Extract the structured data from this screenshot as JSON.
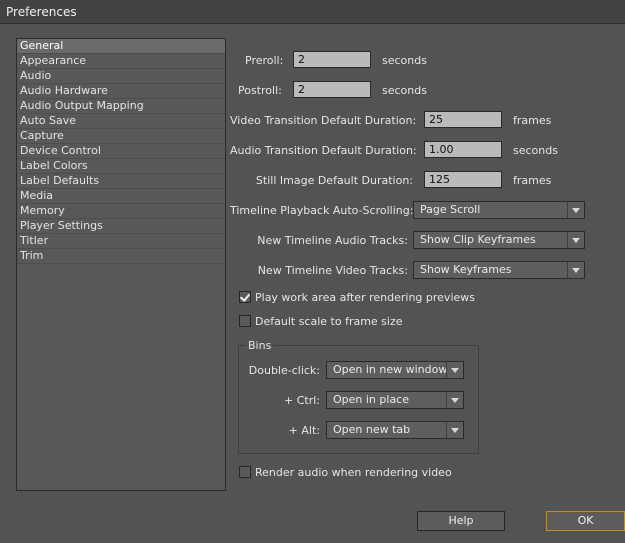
{
  "window": {
    "title": "Preferences"
  },
  "sidebar": {
    "items": [
      {
        "label": "General",
        "selected": true
      },
      {
        "label": "Appearance"
      },
      {
        "label": "Audio"
      },
      {
        "label": "Audio Hardware"
      },
      {
        "label": "Audio Output Mapping"
      },
      {
        "label": "Auto Save"
      },
      {
        "label": "Capture"
      },
      {
        "label": "Device Control"
      },
      {
        "label": "Label Colors"
      },
      {
        "label": "Label Defaults"
      },
      {
        "label": "Media"
      },
      {
        "label": "Memory"
      },
      {
        "label": "Player Settings"
      },
      {
        "label": "Titler"
      },
      {
        "label": "Trim"
      }
    ]
  },
  "general": {
    "preroll": {
      "label": "Preroll:",
      "value": "2",
      "unit": "seconds"
    },
    "postroll": {
      "label": "Postroll:",
      "value": "2",
      "unit": "seconds"
    },
    "video_transition": {
      "label": "Video Transition Default Duration:",
      "value": "25",
      "unit": "frames"
    },
    "audio_transition": {
      "label": "Audio Transition Default Duration:",
      "value": "1.00",
      "unit": "seconds"
    },
    "still_image": {
      "label": "Still Image Default Duration:",
      "value": "125",
      "unit": "frames"
    },
    "timeline_autoscroll": {
      "label": "Timeline Playback Auto-Scrolling:",
      "value": "Page Scroll"
    },
    "audio_tracks": {
      "label": "New Timeline Audio Tracks:",
      "value": "Show Clip Keyframes"
    },
    "video_tracks": {
      "label": "New Timeline Video Tracks:",
      "value": "Show Keyframes"
    },
    "play_work_area": {
      "label": "Play work area after rendering previews",
      "checked": true
    },
    "default_scale": {
      "label": "Default scale to frame size",
      "checked": false
    },
    "render_audio": {
      "label": "Render audio when rendering video",
      "checked": false
    }
  },
  "bins": {
    "title": "Bins",
    "double_click": {
      "label": "Double-click:",
      "value": "Open in new window"
    },
    "ctrl": {
      "label": "+ Ctrl:",
      "value": "Open in place"
    },
    "alt": {
      "label": "+ Alt:",
      "value": "Open new tab"
    }
  },
  "buttons": {
    "help": "Help",
    "ok": "OK"
  },
  "colors": {
    "background": "#535353",
    "ok_border": "#b8903a"
  }
}
